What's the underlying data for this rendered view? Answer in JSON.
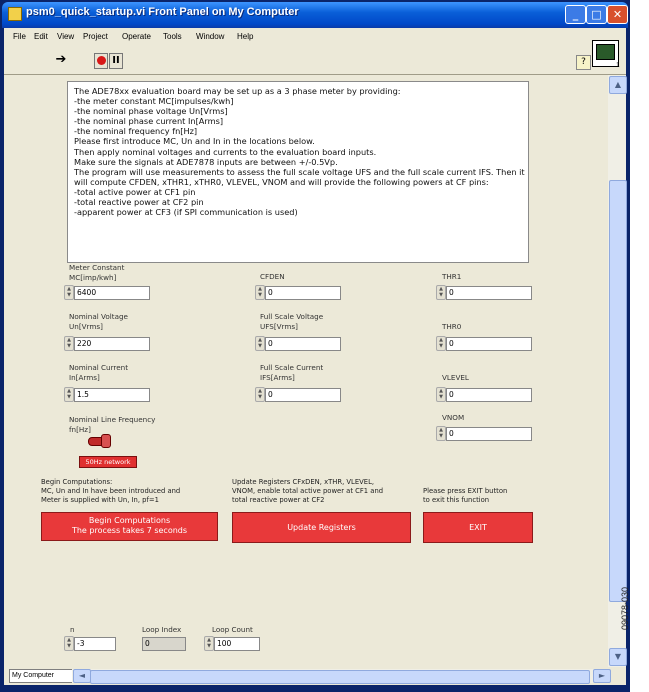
{
  "window": {
    "title": "psm0_quick_startup.vi Front Panel on My Computer"
  },
  "menu": [
    "File",
    "Edit",
    "View",
    "Project",
    "Operate",
    "Tools",
    "Window",
    "Help"
  ],
  "toolbar": {
    "run_icon": "run-arrow-icon",
    "stop_icon": "abort-icon",
    "pause_label": "II",
    "help_label": "?",
    "vi_icon_number": "1"
  },
  "description": "The ADE78xx evaluation board may be set up as a 3 phase meter by providing:\n-the meter constant MC[impulses/kwh]\n-the nominal phase voltage Un[Vrms]\n-the nominal phase current In[Arms]\n-the nominal frequency fn[Hz]\nPlease first introduce MC, Un and In in the locations below.\nThen apply nominal voltages and currents to the evaluation board inputs.\nMake sure the signals at ADE7878 inputs are between +/-0.5Vp.\nThe program will use measurements to assess the full scale voltage UFS and the full scale current IFS. Then it will compute CFDEN, xTHR1, xTHR0, VLEVEL, VNOM and will provide the following powers at CF pins:\n-total active power at CF1 pin\n-total reactive power at CF2 pin\n-apparent power at CF3 (if SPI communication is used)",
  "inputs": {
    "meter_constant": {
      "label1": "Meter Constant",
      "label2": "MC[imp/kwh]",
      "value": "6400"
    },
    "nominal_voltage": {
      "label1": "Nominal Voltage",
      "label2": "Un[Vrms]",
      "value": "220"
    },
    "nominal_current": {
      "label1": "Nominal Current",
      "label2": "In[Arms]",
      "value": "1.5"
    },
    "nominal_frequency": {
      "label1": "Nominal Line Frequency",
      "label2": "fn[Hz]",
      "indicator": "50Hz network"
    }
  },
  "outputs": {
    "cfden": {
      "label": "CFDEN",
      "value": "0"
    },
    "ufs": {
      "label1": "Full Scale Voltage",
      "label2": "UFS[Vrms]",
      "value": "0"
    },
    "ifs": {
      "label1": "Full Scale Current",
      "label2": "IFS[Arms]",
      "value": "0"
    },
    "thr1": {
      "label": "THR1",
      "value": "0"
    },
    "thr0": {
      "label": "THR0",
      "value": "0"
    },
    "vlevel": {
      "label": "VLEVEL",
      "value": "0"
    },
    "vnom": {
      "label": "VNOM",
      "value": "0"
    }
  },
  "actions": {
    "begin_note": "Begin Computations:\nMC, Un and In have been introduced and\nMeter is supplied with Un, In, pf=1",
    "begin_label": "Begin Computations\nThe process takes 7 seconds",
    "update_note": "Update Registers CFxDEN, xTHR, VLEVEL,\nVNOM, enable total active power at CF1 and\ntotal reactive power at CF2",
    "update_label": "Update Registers",
    "exit_note": "Please press EXIT button\nto exit this function",
    "exit_label": "EXIT"
  },
  "loop": {
    "n": {
      "label": "n",
      "value": "-3"
    },
    "loop_index": {
      "label": "Loop Index",
      "value": "0"
    },
    "loop_count": {
      "label": "Loop Count",
      "value": "100"
    }
  },
  "status": {
    "context": "My Computer"
  },
  "figure_code": "09078-030"
}
